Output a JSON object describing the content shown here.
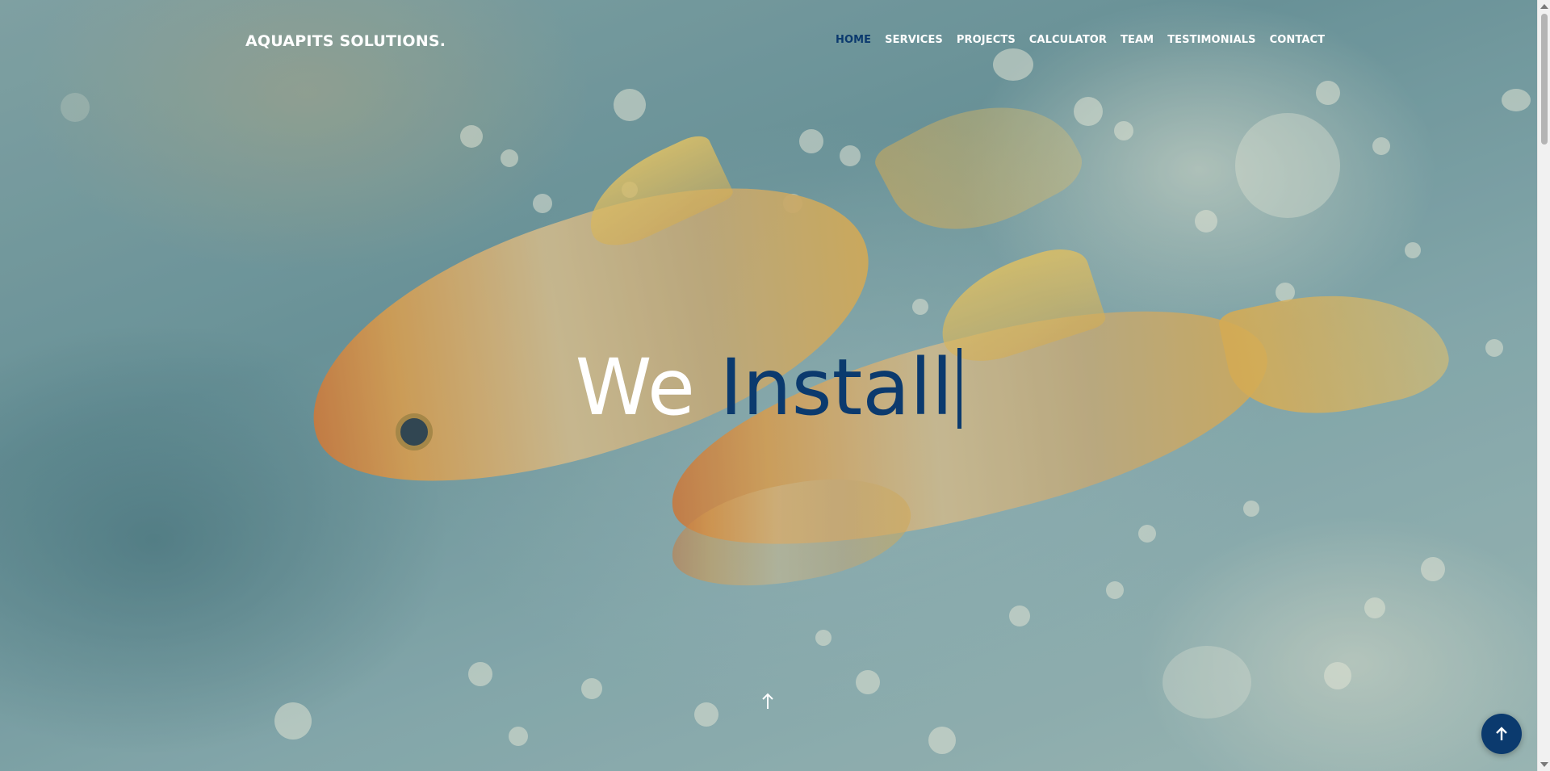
{
  "brand": {
    "logo": "AQUAPITS SOLUTIONS."
  },
  "nav": {
    "items": [
      "HOME",
      "SERVICES",
      "PROJECTS",
      "CALCULATOR",
      "TEAM",
      "TESTIMONIALS",
      "CONTACT"
    ],
    "active": "HOME"
  },
  "hero": {
    "static_text": "We",
    "typed_text": "Install"
  },
  "icons": {
    "scroll_down": "arrow-up-icon",
    "back_to_top": "arrow-up-icon"
  },
  "colors": {
    "accent": "#0b3a6e",
    "text_light": "#ffffff"
  }
}
